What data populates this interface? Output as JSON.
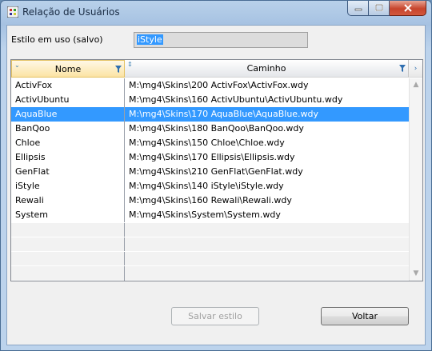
{
  "window": {
    "title": "Relação de Usuários"
  },
  "style": {
    "label": "Estilo em uso (salvo)",
    "value": "iStyle"
  },
  "grid": {
    "columns": [
      "Nome",
      "Caminho"
    ],
    "selected_index": 2,
    "rows": [
      {
        "nome": "ActivFox",
        "caminho": "M:\\mg4\\Skins\\200 ActivFox\\ActivFox.wdy"
      },
      {
        "nome": "ActivUbuntu",
        "caminho": "M:\\mg4\\Skins\\160 ActivUbuntu\\ActivUbuntu.wdy"
      },
      {
        "nome": "AquaBlue",
        "caminho": "M:\\mg4\\Skins\\170 AquaBlue\\AquaBlue.wdy"
      },
      {
        "nome": "BanQoo",
        "caminho": "M:\\mg4\\Skins\\180 BanQoo\\BanQoo.wdy"
      },
      {
        "nome": "Chloe",
        "caminho": "M:\\mg4\\Skins\\150 Chloe\\Chloe.wdy"
      },
      {
        "nome": "Ellipsis",
        "caminho": "M:\\mg4\\Skins\\170 Ellipsis\\Ellipsis.wdy"
      },
      {
        "nome": "GenFlat",
        "caminho": "M:\\mg4\\Skins\\210 GenFlat\\GenFlat.wdy"
      },
      {
        "nome": "iStyle",
        "caminho": "M:\\mg4\\Skins\\140 iStyle\\iStyle.wdy"
      },
      {
        "nome": "Rewali",
        "caminho": "M:\\mg4\\Skins\\160 Rewali\\Rewali.wdy"
      },
      {
        "nome": "System",
        "caminho": "M:\\mg4\\Skins\\System\\System.wdy"
      }
    ]
  },
  "buttons": {
    "save_label": "Salvar estilo",
    "back_label": "Voltar"
  },
  "colors": {
    "selection": "#3399ff",
    "close": "#c7442c"
  }
}
